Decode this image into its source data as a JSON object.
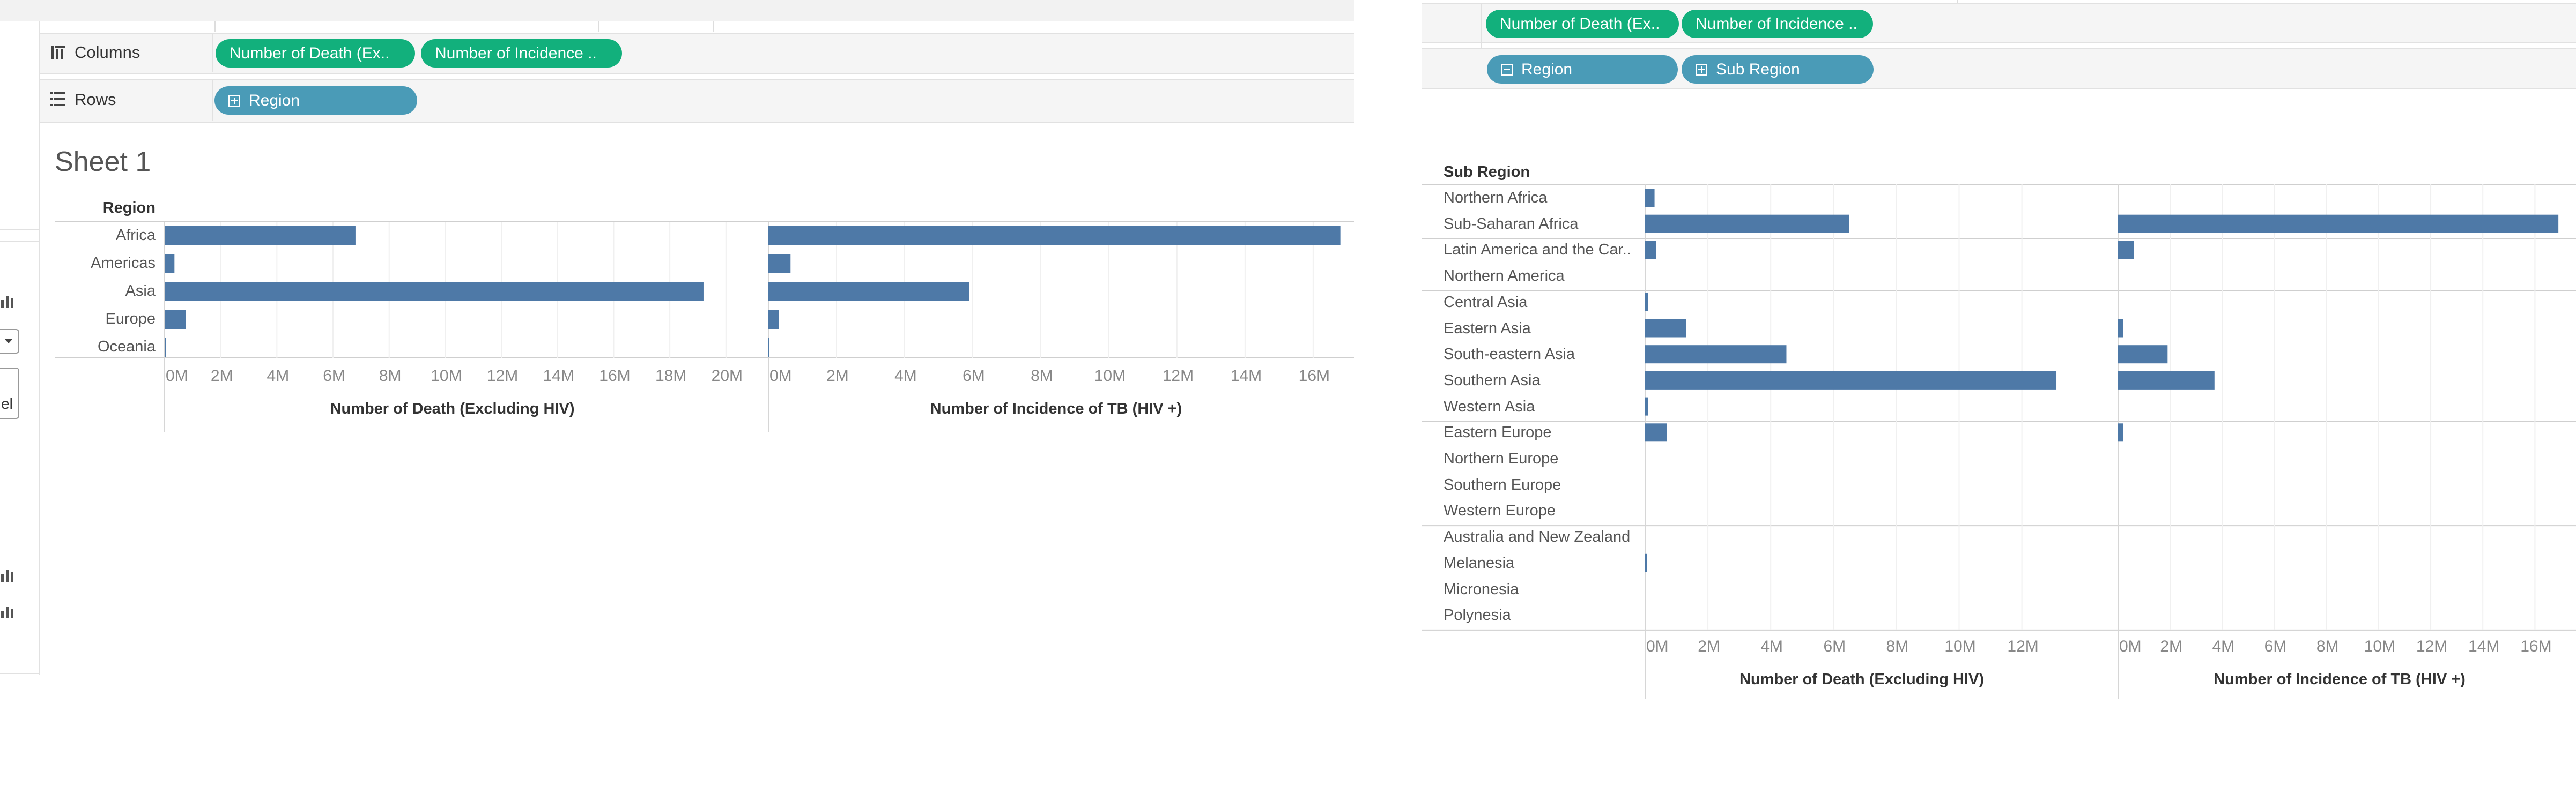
{
  "left": {
    "shelves": {
      "columns_label": "Columns",
      "rows_label": "Rows",
      "column_pills": [
        "Number of Death (Ex..",
        "Number of Incidence .."
      ],
      "row_pills": [
        "Region"
      ]
    },
    "sheet_title": "Sheet 1",
    "side_text": "el",
    "chart": {
      "header": "Region",
      "categories": [
        "Africa",
        "Americas",
        "Asia",
        "Europe",
        "Oceania"
      ],
      "panes": [
        {
          "xlabel": "Number of Death (Excluding HIV)",
          "ticks": [
            "0M",
            "2M",
            "4M",
            "6M",
            "8M",
            "10M",
            "12M",
            "14M",
            "16M",
            "18M",
            "20M"
          ],
          "xlim": [
            0,
            20.5
          ],
          "values": [
            6.8,
            0.35,
            19.2,
            0.75,
            0.05
          ]
        },
        {
          "xlabel": "Number of Incidence of TB (HIV +)",
          "ticks": [
            "0M",
            "2M",
            "4M",
            "6M",
            "8M",
            "10M",
            "12M",
            "14M",
            "16M"
          ],
          "xlim": [
            0,
            16.9
          ],
          "values": [
            16.8,
            0.65,
            5.9,
            0.3,
            0.03
          ]
        }
      ]
    }
  },
  "right": {
    "shelves": {
      "column_pills": [
        "Number of Death (Ex..",
        "Number of Incidence .."
      ],
      "row_pills": [
        "Region",
        "Sub Region"
      ]
    },
    "chart": {
      "header": "Sub Region",
      "groups": [
        [
          "Northern Africa",
          "Sub-Saharan Africa"
        ],
        [
          "Latin America and the Car..",
          "Northern America"
        ],
        [
          "Central Asia",
          "Eastern Asia",
          "South-eastern Asia",
          "Southern Asia",
          "Western Asia"
        ],
        [
          "Eastern Europe",
          "Northern Europe",
          "Southern Europe",
          "Western Europe"
        ],
        [
          "Australia and New Zealand",
          "Melanesia",
          "Micronesia",
          "Polynesia"
        ]
      ],
      "panes": [
        {
          "xlabel": "Number of Death (Excluding HIV)",
          "ticks": [
            "0M",
            "2M",
            "4M",
            "6M",
            "8M",
            "10M",
            "12M"
          ],
          "xlim": [
            0,
            13.8
          ],
          "values": [
            0.3,
            6.5,
            0.35,
            0,
            0.1,
            1.3,
            4.5,
            13.1,
            0.1,
            0.7,
            0,
            0,
            0,
            0,
            0.05,
            0,
            0
          ]
        },
        {
          "xlabel": "Number of Incidence of TB (HIV +)",
          "ticks": [
            "0M",
            "2M",
            "4M",
            "6M",
            "8M",
            "10M",
            "12M",
            "14M",
            "16M"
          ],
          "xlim": [
            0,
            17.0
          ],
          "values": [
            0,
            16.9,
            0.6,
            0,
            0,
            0.2,
            1.9,
            3.7,
            0,
            0.2,
            0,
            0,
            0,
            0,
            0,
            0,
            0
          ]
        }
      ]
    }
  },
  "colors": {
    "bar": "#4e79a7",
    "green_pill": "#12b07c",
    "blue_pill": "#4a9bb7"
  },
  "icons": [
    "columns-icon",
    "rows-icon",
    "bar-chart-icon",
    "dropdown-icon"
  ]
}
